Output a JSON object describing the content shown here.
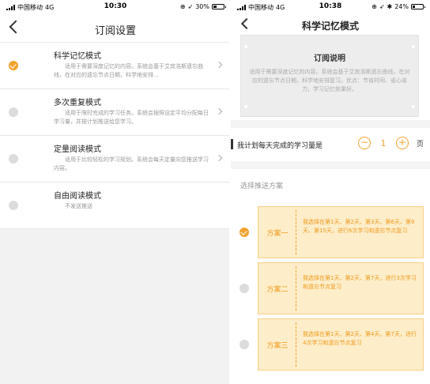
{
  "left": {
    "status": {
      "carrier": "中国移动",
      "network": "4G",
      "time": "10:30",
      "battery": "30%",
      "battery_level": 0.3
    },
    "title": "订阅设置",
    "modes": [
      {
        "name": "科学记忆模式",
        "desc": "适用于需要深度记忆的内容。系统会基于艾宾浩斯遗忘曲线，在对应的遗忘节点日期，科学地安排...",
        "selected": true
      },
      {
        "name": "多次重复模式",
        "desc": "适用于限时完成的学习任务。系统会按照设定平均分配每日学习量，并按计划推送给您学习。",
        "selected": false
      },
      {
        "name": "定量阅读模式",
        "desc": "适用于比较轻松的学习规划。系统会每天定量向您推送学习内容。",
        "selected": false
      },
      {
        "name": "自由阅读模式",
        "desc": "不发送推送",
        "selected": false
      }
    ]
  },
  "right": {
    "status": {
      "carrier": "中国移动",
      "network": "4G",
      "time": "10:38",
      "battery": "24%",
      "battery_level": 0.24
    },
    "title": "科学记忆模式",
    "explain": {
      "heading": "订阅说明",
      "body": "适用于需要深度记忆的内容。系统会基于艾宾浩斯遗忘曲线，在对应的遗忘节点日期，科学地安排复习。优点：节省时间、省心省力，学习记忆效果好。"
    },
    "plan": {
      "label": "我计划每天完成的学习量是",
      "minus": "−",
      "count": "1",
      "plus": "+",
      "unit": "页"
    },
    "scheme_section": "选择推送方案",
    "schemes": [
      {
        "name": "方案一",
        "text": "我选择在第1天、第2天、第3天、第6天、第9天、第15天，进行6次学习和遗忘节点复习",
        "selected": true
      },
      {
        "name": "方案二",
        "text": "我选择在第1天、第2天、第7天，进行3次学习和遗忘节点复习",
        "selected": false
      },
      {
        "name": "方案三",
        "text": "我选择在第1天、第2天、第4天、第7天，进行4次学习和遗忘节点复习",
        "selected": false
      }
    ]
  }
}
